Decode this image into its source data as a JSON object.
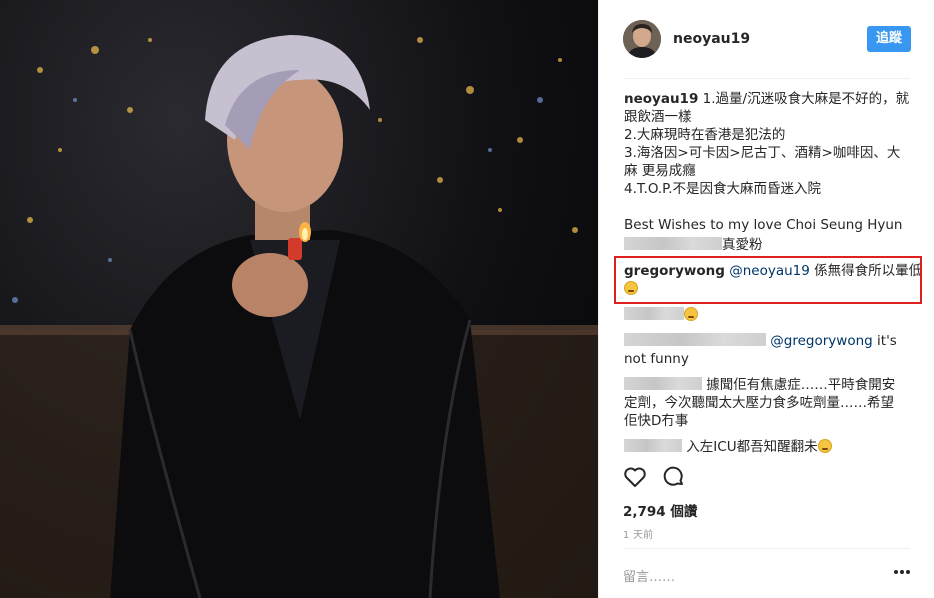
{
  "header": {
    "username": "neoyau19",
    "follow_label": "追蹤"
  },
  "caption": {
    "user": "neoyau19",
    "lines": [
      " 1.過量/沉迷吸食大麻是不好的，就",
      "跟飲酒一樣",
      "2.大麻現時在香港是犯法的",
      "3.海洛因>可卡因>尼古丁、酒精>咖啡因、大",
      "麻 更易成癮",
      "4.T.O.P.不是因食大麻而昏迷入院"
    ],
    "wishes": "Best Wishes to my love Choi Seung Hyun"
  },
  "comments": [
    {
      "text": "真愛粉"
    },
    {
      "user": "gregorywong",
      "mention": "@neoyau19",
      "text": " 係無得食所以暈低"
    },
    {
      "text": ""
    },
    {
      "mention": "@gregorywong",
      "text": " it's",
      "text2": "not funny"
    },
    {
      "text": "據聞佢有焦慮症……平時食開安",
      "text2": "定劑，今次聽聞太大壓力食多咗劑量……希望",
      "text3": "佢快D冇事"
    },
    {
      "text": "入左ICU都吾知醒翻未"
    }
  ],
  "likes": "2,794 個讚",
  "time": "1 天前",
  "comment_placeholder": "留言……",
  "icons": {
    "like": "heart-icon",
    "comment": "comment-bubble-icon",
    "more": "more-dots-icon"
  },
  "colors": {
    "accent": "#3897f0",
    "highlight": "#e02020",
    "text": "#262626"
  }
}
